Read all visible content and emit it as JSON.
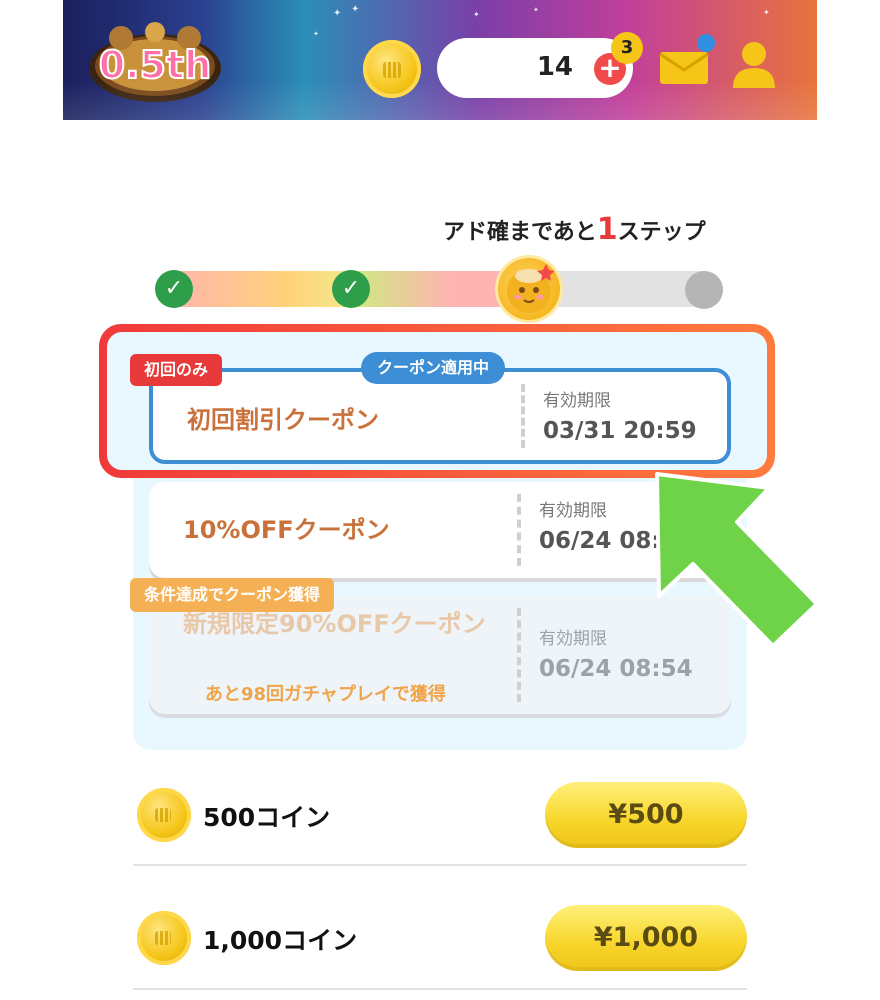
{
  "header": {
    "logo_text": "0.5th",
    "balance": "14",
    "plus_symbol": "+",
    "plus_badge": "3",
    "icons": [
      "coin-icon",
      "plus-icon",
      "mail-icon",
      "user-icon"
    ]
  },
  "step": {
    "prefix": "アド確まであと",
    "count": "1",
    "suffix": "ステップ",
    "progress": {
      "completed": 2,
      "total_markers": 4,
      "current": 3
    }
  },
  "coupons": [
    {
      "tag": "初回のみ",
      "status": "クーポン適用中",
      "name": "初回割引クーポン",
      "expiry_label": "有効期限",
      "expiry": "03/31 20:59"
    },
    {
      "name": "10%OFFクーポン",
      "expiry_label": "有効期限",
      "expiry": "06/24 08:54"
    },
    {
      "tag": "条件達成でクーポン獲得",
      "name": "新規限定90%OFFクーポン",
      "note": "あと98回ガチャプレイで獲得",
      "expiry_label": "有効期限",
      "expiry": "06/24 08:54"
    }
  ],
  "packs": [
    {
      "label": "500コイン",
      "price": "¥500"
    },
    {
      "label": "1,000コイン",
      "price": "¥1,000"
    }
  ],
  "colors": {
    "accent_red": "#e83a3a",
    "applied_blue": "#3d8ed4",
    "coupon_orange": "#c9713a",
    "price_yellow": "#f7d52a",
    "arrow_green": "#6fd34a"
  }
}
